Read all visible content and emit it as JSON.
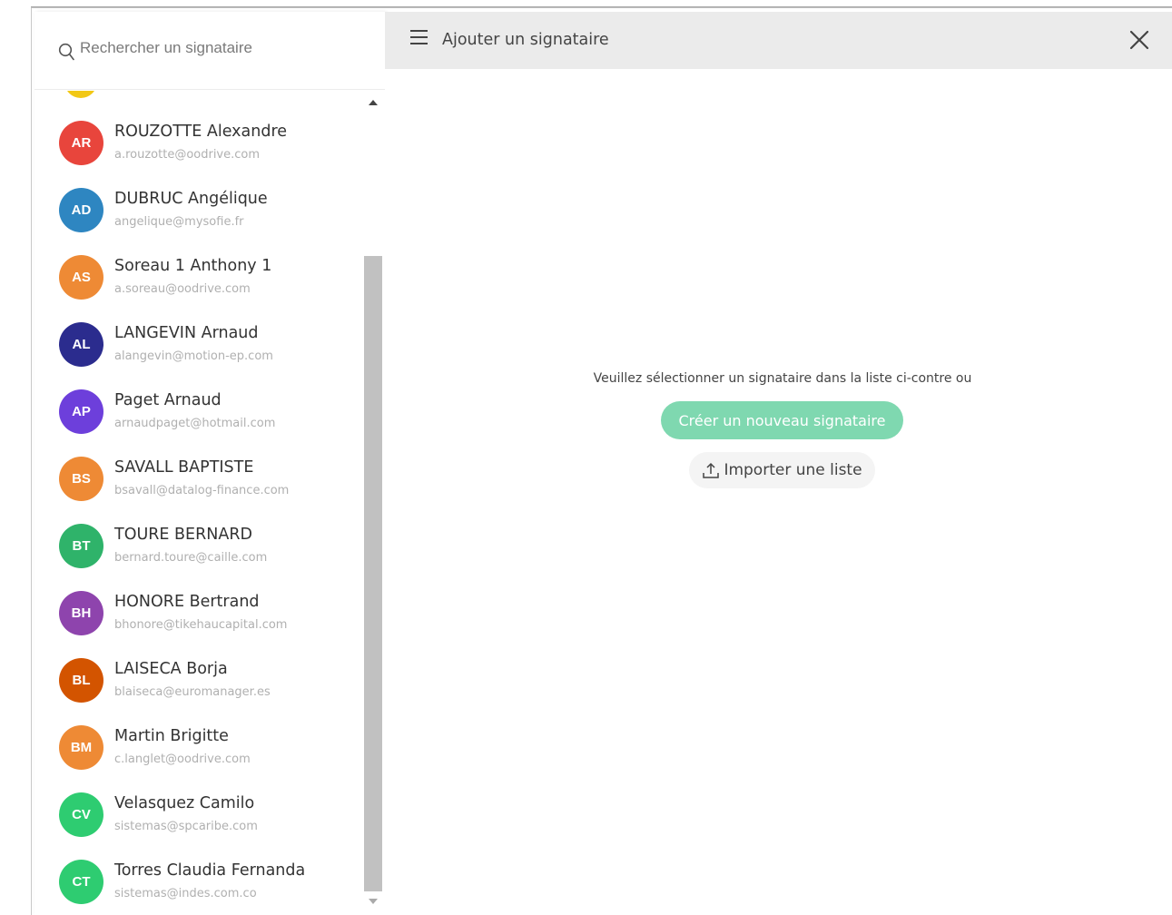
{
  "search": {
    "placeholder": "Rechercher un signataire"
  },
  "contacts": [
    {
      "initials": "AR",
      "name": "ROUZOTTE Alexandre",
      "email": "a.rouzotte@oodrive.com",
      "color": "#e8453c"
    },
    {
      "initials": "AD",
      "name": "DUBRUC Angélique",
      "email": "angelique@mysofie.fr",
      "color": "#2e86c1"
    },
    {
      "initials": "AS",
      "name": "Soreau 1 Anthony 1",
      "email": "a.soreau@oodrive.com",
      "color": "#ee8a35"
    },
    {
      "initials": "AL",
      "name": "LANGEVIN Arnaud",
      "email": "alangevin@motion-ep.com",
      "color": "#2b2c8e"
    },
    {
      "initials": "AP",
      "name": "Paget Arnaud",
      "email": "arnaudpaget@hotmail.com",
      "color": "#6d3fdb"
    },
    {
      "initials": "BS",
      "name": "SAVALL BAPTISTE",
      "email": "bsavall@datalog-finance.com",
      "color": "#ee8a35"
    },
    {
      "initials": "BT",
      "name": "TOURE BERNARD",
      "email": "bernard.toure@caille.com",
      "color": "#2fb36a"
    },
    {
      "initials": "BH",
      "name": "HONORE Bertrand",
      "email": "bhonore@tikehaucapital.com",
      "color": "#8e44ad"
    },
    {
      "initials": "BL",
      "name": "LAISECA Borja",
      "email": "blaiseca@euromanager.es",
      "color": "#d35400"
    },
    {
      "initials": "BM",
      "name": "Martin Brigitte",
      "email": "c.langlet@oodrive.com",
      "color": "#ee8a35"
    },
    {
      "initials": "CV",
      "name": "Velasquez Camilo",
      "email": "sistemas@spcaribe.com",
      "color": "#2ecc71"
    },
    {
      "initials": "CT",
      "name": "Torres Claudia Fernanda",
      "email": "sistemas@indes.com.co",
      "color": "#2ecc71"
    }
  ],
  "header": {
    "title": "Ajouter un signataire"
  },
  "main": {
    "hint": "Veuillez sélectionner un signataire dans la liste ci-contre ou",
    "create_button": "Créer un nouveau signataire",
    "import_button": "Importer une liste"
  },
  "colors": {
    "accent": "#7fd8b0",
    "header_bg": "#ebebeb",
    "partial_avatar": "#f2c815"
  }
}
